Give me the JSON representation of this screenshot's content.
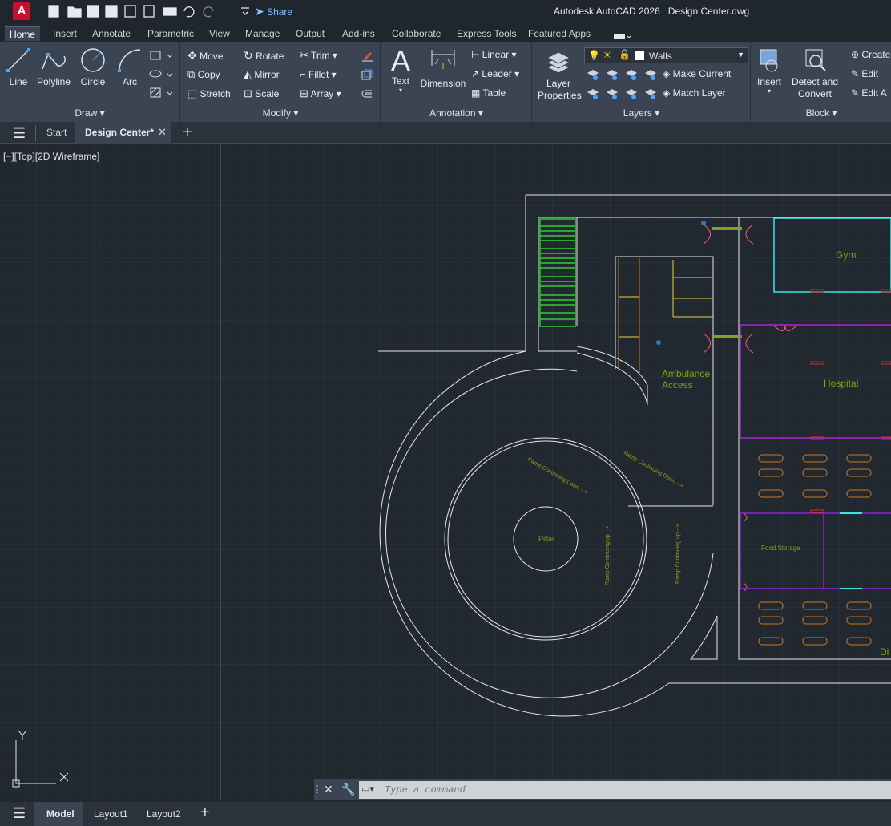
{
  "app": {
    "title": "Autodesk AutoCAD 2026",
    "document": "Design Center.dwg",
    "logo_letter": "A",
    "share_label": "Share"
  },
  "ribbon_tabs": [
    "Home",
    "Insert",
    "Annotate",
    "Parametric",
    "View",
    "Manage",
    "Output",
    "Add-ins",
    "Collaborate",
    "Express Tools",
    "Featured Apps"
  ],
  "draw_panel": {
    "title": "Draw",
    "line": "Line",
    "polyline": "Polyline",
    "circle": "Circle",
    "arc": "Arc"
  },
  "modify_panel": {
    "title": "Modify",
    "move": "Move",
    "rotate": "Rotate",
    "trim": "Trim",
    "copy": "Copy",
    "mirror": "Mirror",
    "fillet": "Fillet",
    "stretch": "Stretch",
    "scale": "Scale",
    "array": "Array"
  },
  "annotation_panel": {
    "title": "Annotation",
    "text": "Text",
    "dimension": "Dimension",
    "linear": "Linear",
    "leader": "Leader",
    "table": "Table"
  },
  "layers_panel": {
    "title": "Layers",
    "layer_properties": "Layer Properties",
    "current_layer": "Walls",
    "make_current": "Make Current",
    "match_layer": "Match Layer"
  },
  "block_panel": {
    "title": "Block",
    "insert": "Insert",
    "detect_convert": "Detect and Convert",
    "create": "Create",
    "edit": "Edit",
    "edit_attributes": "Edit A"
  },
  "file_tabs": {
    "start": "Start",
    "active": "Design Center*"
  },
  "viewport_label": "[−][Top][2D Wireframe]",
  "drawing_labels": {
    "gym": "Gym",
    "hospital": "Hospital",
    "ambulance": "Ambulance",
    "access": "Access",
    "pillar": "Pillar",
    "ramp_down_1": "Ramp Continuing Down -->",
    "ramp_down_2": "Ramp Continuing Down -->",
    "ramp_up_1": "Ramp Continuing up -->",
    "ramp_up_2": "Ramp Continuing up -->",
    "food_storage": "Food Storage",
    "dining_partial": "Di"
  },
  "ucs": {
    "x": "X",
    "y": "Y"
  },
  "command": {
    "placeholder": "Type a command"
  },
  "layout_tabs": {
    "model": "Model",
    "layout1": "Layout1",
    "layout2": "Layout2"
  },
  "colors": {
    "accent_red": "#c8102e",
    "ribbon": "#3b4453",
    "canvas": "#212830",
    "gym": "#36e8e0",
    "hospital": "#b020e0",
    "green": "#2ed02e",
    "yellow": "#e8d23a",
    "orange": "#d0781e"
  }
}
